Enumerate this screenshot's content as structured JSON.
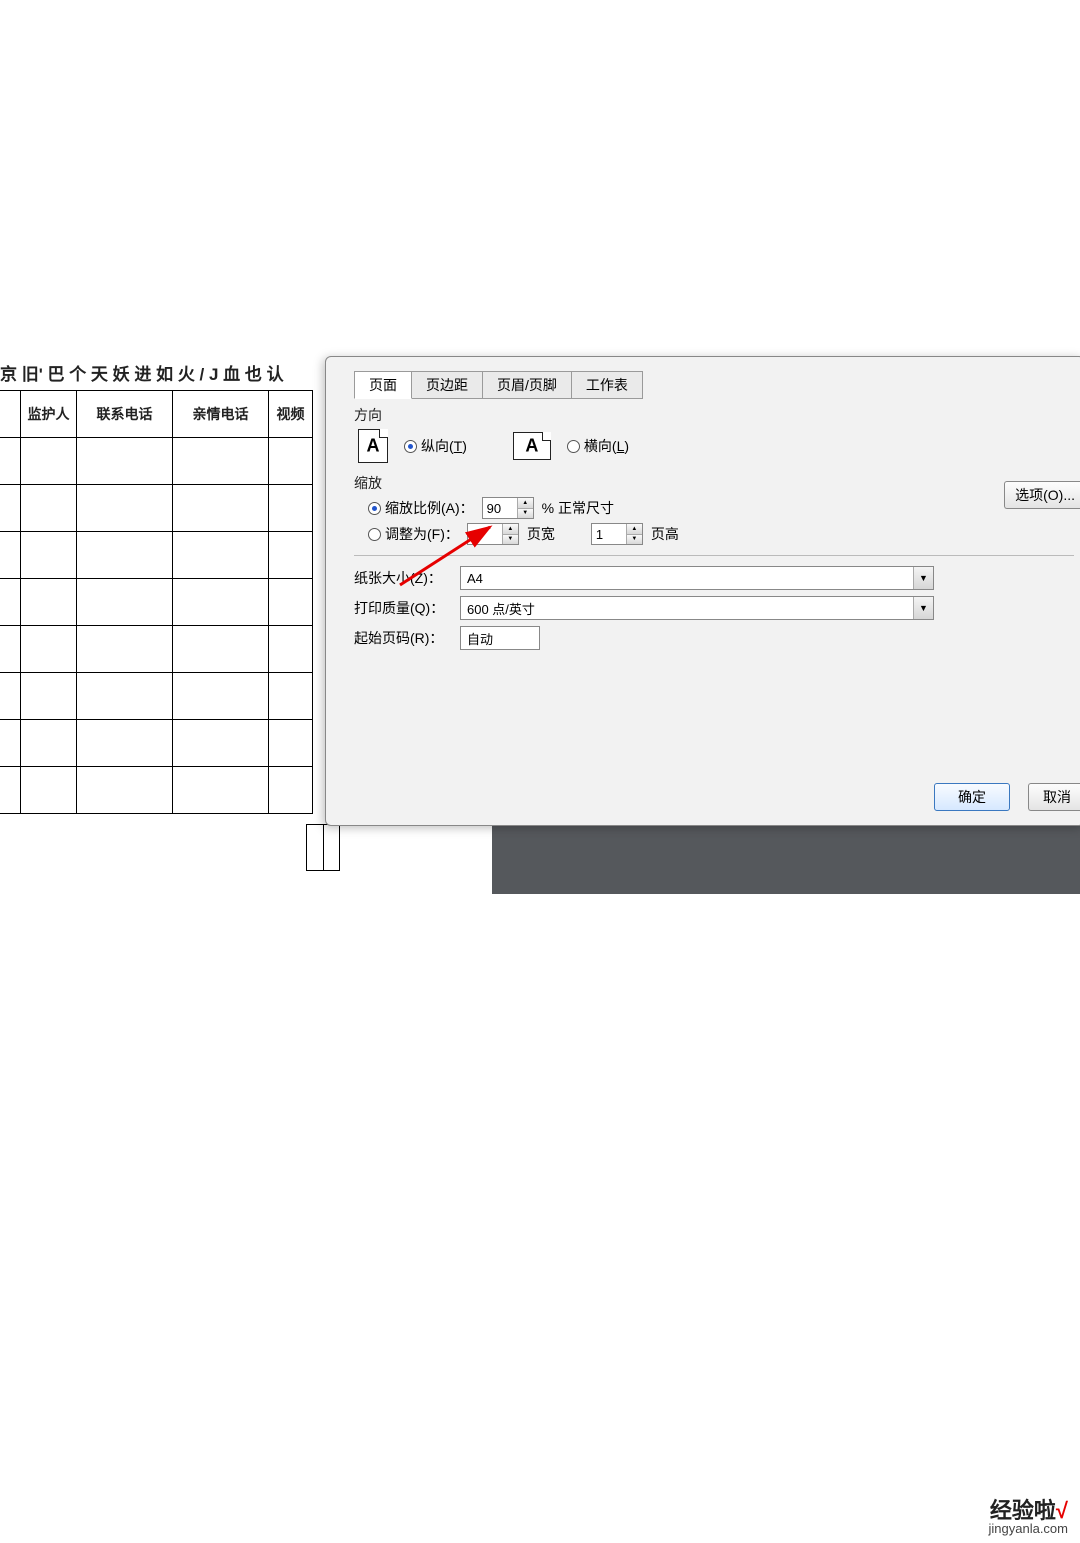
{
  "sheet": {
    "title_fragment": "京 旧' 巴 个 天 妖 进 如 火 / J 血 也 认",
    "headers": [
      "",
      "监护人",
      "联系电话",
      "亲情电话",
      "视频"
    ],
    "rows": 9
  },
  "dialog": {
    "tabs": [
      "页面",
      "页边距",
      "页眉/页脚",
      "工作表"
    ],
    "active_tab": 0,
    "orientation": {
      "label": "方向",
      "portrait": "纵向(T)",
      "landscape": "横向(L)",
      "hotkey_t": "T",
      "hotkey_l": "L",
      "selected": "portrait"
    },
    "zoom": {
      "label": "缩放",
      "ratio_label": "缩放比例(A)：",
      "ratio_value": "90",
      "suffix": "% 正常尺寸",
      "fit_label": "调整为(F)：",
      "fit_wide_value": "1",
      "fit_wide_label": "页宽",
      "fit_tall_value": "1",
      "fit_tall_label": "页高",
      "selected": "ratio"
    },
    "paper": {
      "label": "纸张大小(Z)：",
      "value": "A4"
    },
    "quality": {
      "label": "打印质量(Q)：",
      "value": "600 点/英寸"
    },
    "first_page": {
      "label": "起始页码(R)：",
      "value": "自动"
    },
    "options_btn": "选项(O)...",
    "ok_btn": "确定",
    "cancel_btn": "取消"
  },
  "footer": {
    "brand": "经验啦",
    "check": "√",
    "domain": "jingyanla.com"
  }
}
